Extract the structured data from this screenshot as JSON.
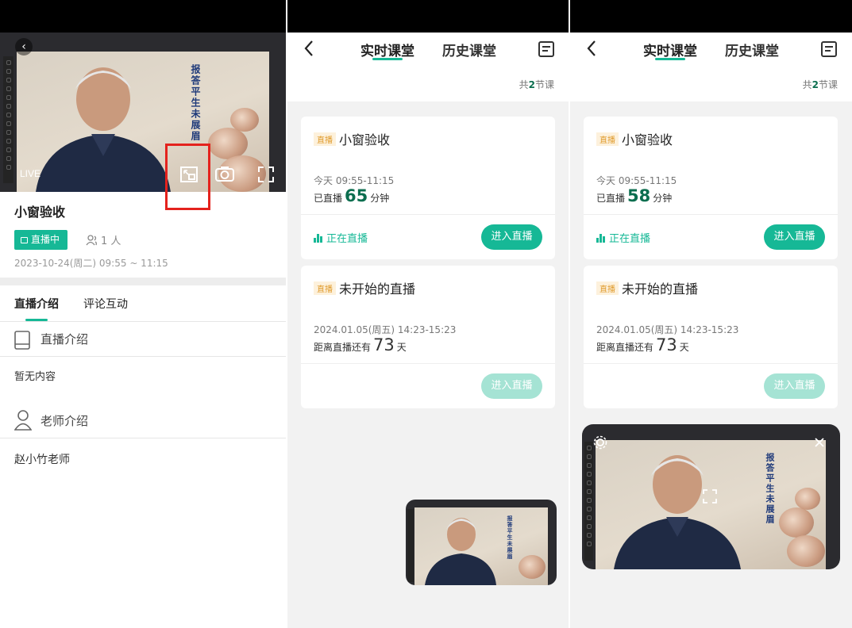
{
  "panel1": {
    "live_tag": "LIVE",
    "calligraphy": "报答平生未展眉",
    "course_title": "小窗验收",
    "status_badge": "直播中",
    "viewer_count": "1 人",
    "datetime": "2023-10-24(周二) 09:55 ~ 11:15",
    "tabs": [
      "直播介绍",
      "评论互动"
    ],
    "intro_heading": "直播介绍",
    "intro_body": "暂无内容",
    "teacher_heading": "老师介绍",
    "teacher_name": "赵小竹老师"
  },
  "list": {
    "tabs": [
      "实时课堂",
      "历史课堂"
    ],
    "count_prefix": "共",
    "count_num": "2",
    "count_suffix": "节课",
    "cards": [
      {
        "tag": "直播",
        "title": "小窗验收",
        "time": "今天 09:55-11:15",
        "stat_prefix": "已直播",
        "stat_suffix": "分钟",
        "status": "正在直播",
        "button": "进入直播"
      },
      {
        "tag": "直播",
        "title": "未开始的直播",
        "time": "2024.01.05(周五)  14:23-15:23",
        "stat_prefix": "距离直播还有",
        "stat_num": "73",
        "stat_suffix": "天",
        "button": "进入直播"
      }
    ]
  },
  "panel2": {
    "minutes_live": "65"
  },
  "panel3": {
    "minutes_live": "58"
  },
  "colors": {
    "accent": "#16b896",
    "dark_green": "#0c6e4f",
    "tag_orange": "#e09b2c",
    "highlight_red": "#e4221d"
  },
  "icons": [
    "back-icon",
    "pip-icon",
    "camera-icon",
    "fullscreen-icon",
    "users-icon",
    "tv-icon",
    "book-icon",
    "person-icon",
    "calendar-icon",
    "chevron-left-icon",
    "live-bars-icon",
    "settings-icon",
    "close-icon"
  ]
}
